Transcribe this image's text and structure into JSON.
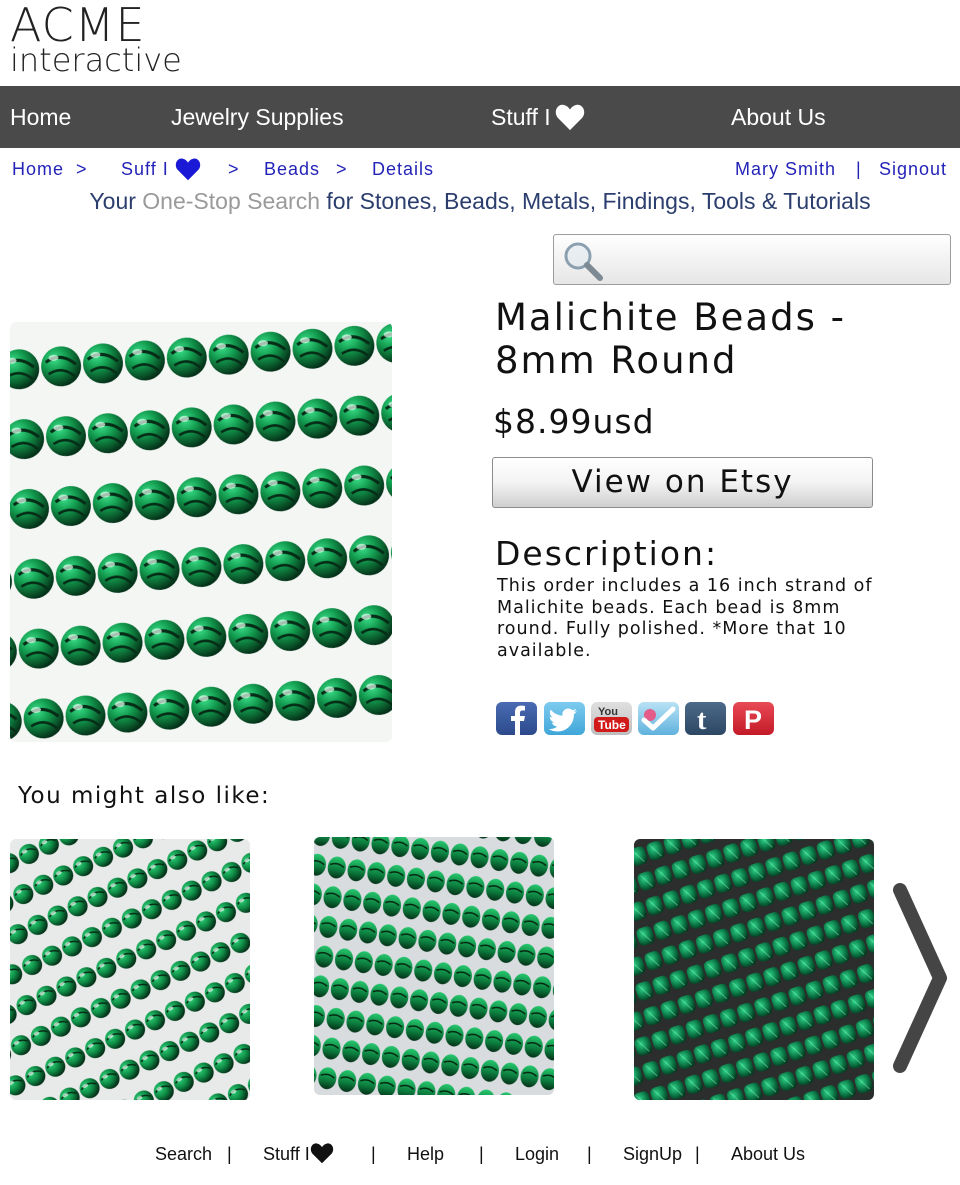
{
  "logo": {
    "line1": "ACME",
    "line2": "interactive"
  },
  "nav": {
    "home": "Home",
    "jewelry": "Jewelry Supplies",
    "stuff": "Stuff I",
    "about": "About Us"
  },
  "breadcrumb": {
    "home": "Home",
    "stuff": "Suff I",
    "beads": "Beads",
    "details": "Details",
    "separator": ">",
    "user": "Mary Smith",
    "divider": "|",
    "signout": "Signout"
  },
  "tagline": {
    "part1": "Your ",
    "muted": "One-Stop Search",
    "part2": " for Stones, Beads, Metals, Findings, Tools & Tutorials"
  },
  "search": {
    "placeholder": "",
    "value": ""
  },
  "product": {
    "title": "Malichite Beads - 8mm Round",
    "price": "$8.99usd",
    "etsy_button": "View on Etsy",
    "description_heading": "Description:",
    "description": "This order includes a 16 inch strand of Malichite beads. Each bead is 8mm round. Fully polished. *More that 10 available."
  },
  "social": [
    "facebook-icon",
    "twitter-icon",
    "youtube-icon",
    "foursquare-icon",
    "tumblr-icon",
    "pinterest-icon"
  ],
  "related": {
    "heading": "You might also like:"
  },
  "footer": {
    "search": "Search",
    "stuff": "Stuff I",
    "help": "Help",
    "login": "Login",
    "signup": "SignUp",
    "about": "About Us",
    "divider": "|"
  },
  "colors": {
    "nav_bg": "#4a4a4a",
    "link_blue": "#2323b8",
    "tagline": "#2b3e6e",
    "heart_blue": "#1a1ad6",
    "malachite": "#1f9e5a"
  }
}
